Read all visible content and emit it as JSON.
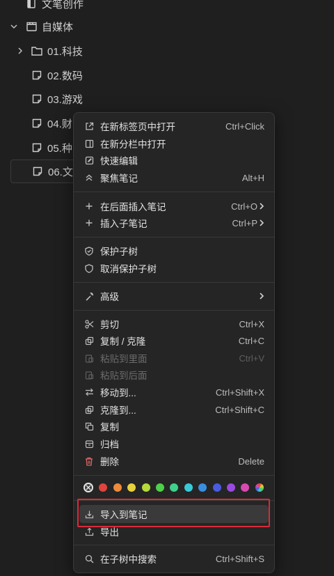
{
  "tree": {
    "items": [
      {
        "label": "文笔创作"
      },
      {
        "label": "自媒体"
      },
      {
        "label": "01.科技"
      },
      {
        "label": "02.数码"
      },
      {
        "label": "03.游戏"
      },
      {
        "label": "04.财"
      },
      {
        "label": "05.种"
      },
      {
        "label": "06.文"
      }
    ]
  },
  "menu": {
    "open_new_tab": {
      "label": "在新标签页中打开",
      "shortcut": "Ctrl+Click"
    },
    "open_new_split": {
      "label": "在新分栏中打开"
    },
    "quick_edit": {
      "label": "快速编辑"
    },
    "focus_note": {
      "label": "聚焦笔记",
      "shortcut": "Alt+H"
    },
    "insert_after": {
      "label": "在后面插入笔记",
      "shortcut": "Ctrl+O"
    },
    "insert_child": {
      "label": "插入子笔记",
      "shortcut": "Ctrl+P"
    },
    "protect_subtree": {
      "label": "保护子树"
    },
    "unprotect_subtree": {
      "label": "取消保护子树"
    },
    "advanced": {
      "label": "高级"
    },
    "cut": {
      "label": "剪切",
      "shortcut": "Ctrl+X"
    },
    "copy_clone": {
      "label": "复制 / 克隆",
      "shortcut": "Ctrl+C"
    },
    "paste_into": {
      "label": "粘贴到里面",
      "shortcut": "Ctrl+V"
    },
    "paste_after": {
      "label": "粘贴到后面"
    },
    "move_to": {
      "label": "移动到...",
      "shortcut": "Ctrl+Shift+X"
    },
    "clone_to": {
      "label": "克隆到...",
      "shortcut": "Ctrl+Shift+C"
    },
    "duplicate": {
      "label": "复制"
    },
    "archive": {
      "label": "归档"
    },
    "delete": {
      "label": "删除",
      "shortcut": "Delete"
    },
    "import_into": {
      "label": "导入到笔记"
    },
    "export": {
      "label": "导出"
    },
    "search_subtree": {
      "label": "在子树中搜索",
      "shortcut": "Ctrl+Shift+S"
    }
  },
  "colors": [
    "#e0443e",
    "#ee8a3a",
    "#e8d13a",
    "#b6d93a",
    "#4fcf4a",
    "#3fd08c",
    "#3ac9d9",
    "#3a8ee0",
    "#4a5be0",
    "#9a4ae0",
    "#d94ab0"
  ],
  "accent": {
    "highlight": "#d92a3a",
    "danger": "#e06666"
  }
}
